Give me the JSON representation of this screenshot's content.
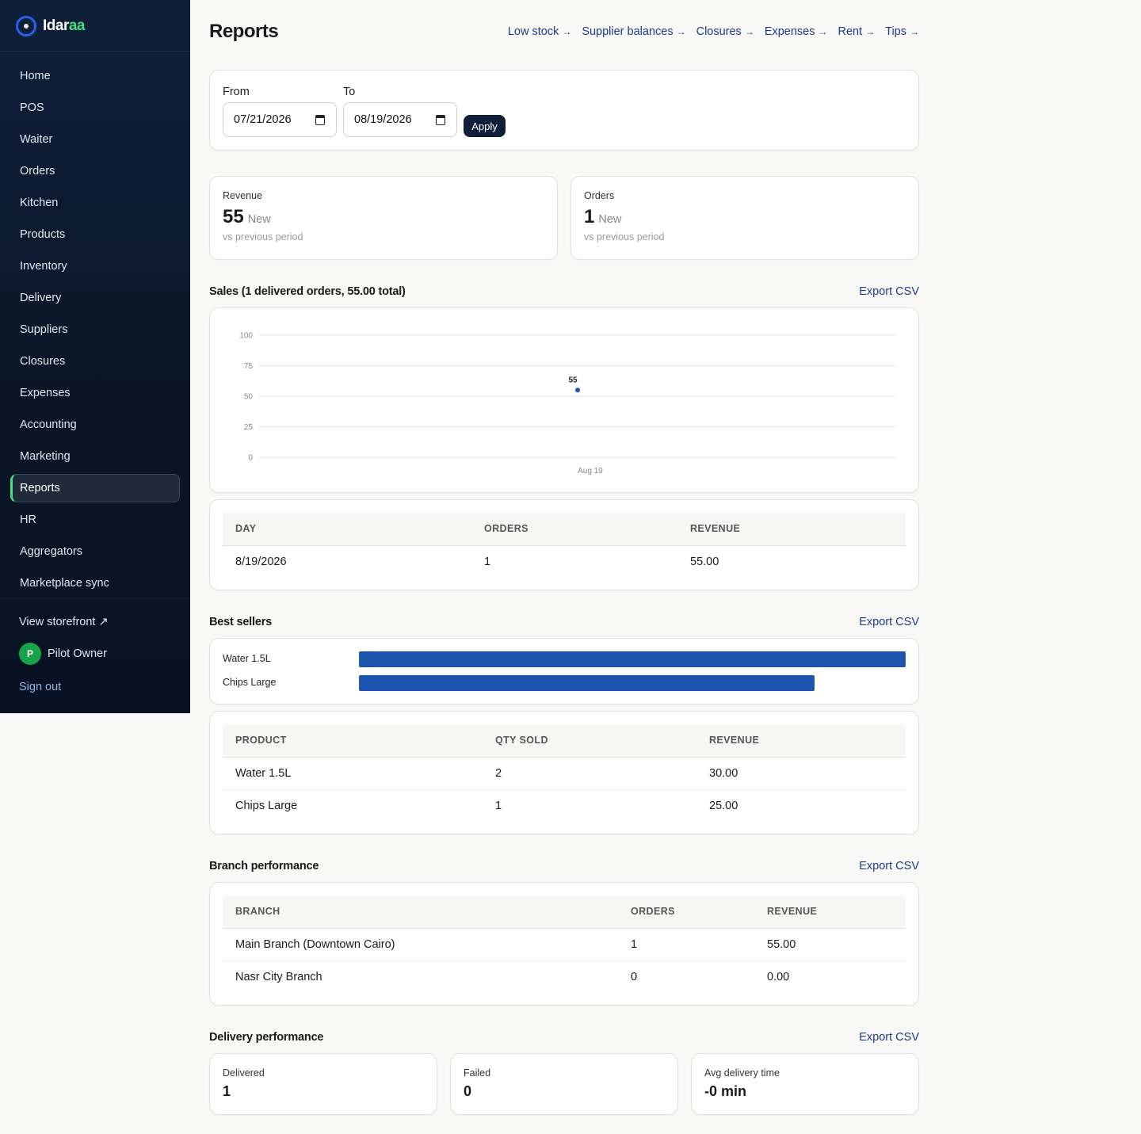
{
  "brand": {
    "name_part1": "Idar",
    "name_part2": "aa"
  },
  "sidebar": {
    "items": [
      {
        "label": "Home"
      },
      {
        "label": "POS"
      },
      {
        "label": "Waiter"
      },
      {
        "label": "Orders"
      },
      {
        "label": "Kitchen"
      },
      {
        "label": "Products"
      },
      {
        "label": "Inventory"
      },
      {
        "label": "Delivery"
      },
      {
        "label": "Suppliers"
      },
      {
        "label": "Closures"
      },
      {
        "label": "Expenses"
      },
      {
        "label": "Accounting"
      },
      {
        "label": "Marketing"
      },
      {
        "label": "Reports",
        "active": true
      },
      {
        "label": "HR"
      },
      {
        "label": "Aggregators"
      },
      {
        "label": "Marketplace sync"
      }
    ],
    "storefront": "View storefront ↗",
    "user_initial": "P",
    "user_name": "Pilot Owner",
    "signout": "Sign out"
  },
  "header": {
    "title": "Reports",
    "links": [
      "Low stock",
      "Supplier balances",
      "Closures",
      "Expenses",
      "Rent",
      "Tips"
    ],
    "arrow": "→"
  },
  "filter": {
    "from_label": "From",
    "from_value": "07/21/2026",
    "to_label": "To",
    "to_value": "08/19/2026",
    "apply": "Apply"
  },
  "stats": [
    {
      "label": "Revenue",
      "value": "55",
      "delta": "New",
      "sub": "vs previous period"
    },
    {
      "label": "Orders",
      "value": "1",
      "delta": "New",
      "sub": "vs previous period"
    }
  ],
  "sales": {
    "title": "Sales (1 delivered orders, 55.00 total)",
    "export": "Export CSV",
    "columns": [
      "DAY",
      "ORDERS",
      "REVENUE"
    ],
    "rows": [
      [
        "8/19/2026",
        "1",
        "55.00"
      ]
    ]
  },
  "chart_data": {
    "type": "line",
    "x": [
      "Aug 19"
    ],
    "series": [
      {
        "values": [
          55
        ]
      }
    ],
    "ylim": [
      0,
      100
    ],
    "yticks": [
      0,
      25,
      50,
      75,
      100
    ],
    "data_labels": [
      "55"
    ],
    "grid": true,
    "color": "#1e55b0"
  },
  "best_sellers": {
    "title": "Best sellers",
    "export": "Export CSV",
    "bars": [
      {
        "label": "Water 1.5L",
        "value": 30
      },
      {
        "label": "Chips Large",
        "value": 25
      }
    ],
    "columns": [
      "PRODUCT",
      "QTY SOLD",
      "REVENUE"
    ],
    "rows": [
      [
        "Water 1.5L",
        "2",
        "30.00"
      ],
      [
        "Chips Large",
        "1",
        "25.00"
      ]
    ]
  },
  "branch": {
    "title": "Branch performance",
    "export": "Export CSV",
    "columns": [
      "BRANCH",
      "ORDERS",
      "REVENUE"
    ],
    "rows": [
      [
        "Main Branch (Downtown Cairo)",
        "1",
        "55.00"
      ],
      [
        "Nasr City Branch",
        "0",
        "0.00"
      ]
    ]
  },
  "delivery": {
    "title": "Delivery performance",
    "export": "Export CSV",
    "cards": [
      {
        "label": "Delivered",
        "value": "1"
      },
      {
        "label": "Failed",
        "value": "0"
      },
      {
        "label": "Avg delivery time",
        "value": "-0 min"
      }
    ]
  }
}
